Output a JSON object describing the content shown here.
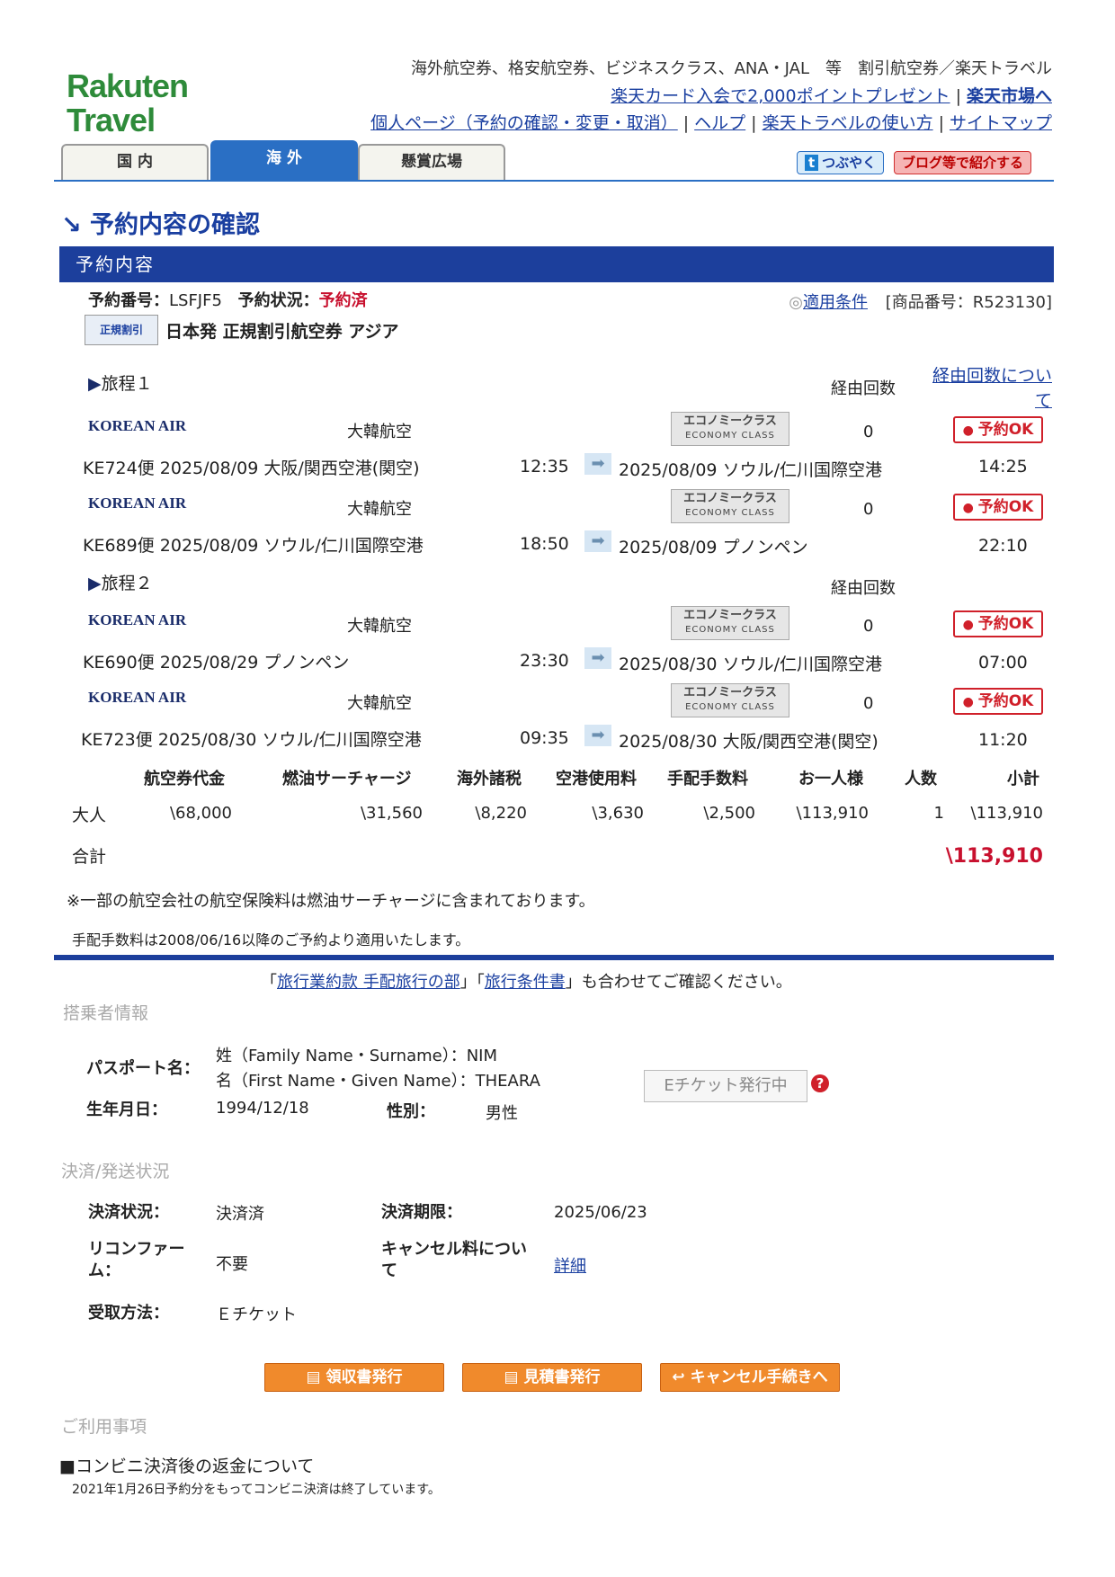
{
  "header": {
    "logo_line1": "Rakuten",
    "logo_line2": "Travel",
    "tagline": "海外航空券、格安航空券、ビジネスクラス、ANA・JAL　等　割引航空券／楽天トラベル",
    "link_card": "楽天カード入会で2,000ポイントプレゼント",
    "link_ichiba": "楽天市場へ",
    "link_mypage": "個人ページ（予約の確認・変更・取消）",
    "link_help": "ヘルプ",
    "link_howto": "楽天トラベルの使い方",
    "link_sitemap": "サイトマップ",
    "tabs": [
      "国 内",
      "海 外",
      "懸賞広場"
    ],
    "sns_tweet": "つぶやく",
    "sns_blog": "ブログ等で紹介する"
  },
  "page_title": "予約内容の確認",
  "section_title": "予約内容",
  "booking": {
    "number_label": "予約番号：",
    "number": "LSFJF5",
    "status_label": "予約状況：",
    "status": "予約済",
    "conditions_link": "適用条件",
    "product_no": "[商品番号：R523130]",
    "badge": "正規割引",
    "product_name": "日本発 正規割引航空券 アジア",
    "via_label": "経由回数",
    "via_link": "経由回数について"
  },
  "itineraries": [
    {
      "label": "旅程１",
      "segments": [
        {
          "airline_logo": "KOREAN AIR",
          "airline": "大韓航空",
          "class_jp": "エコノミークラス",
          "class_en": "ECONOMY CLASS",
          "stops": "0",
          "status": "予約OK",
          "flight": "KE724便",
          "dep_date": "2025/08/09",
          "dep_airport": "大阪/関西空港(関空)",
          "dep_time": "12:35",
          "arr_date": "2025/08/09",
          "arr_airport": "ソウル/仁川国際空港",
          "arr_time": "14:25"
        },
        {
          "airline_logo": "KOREAN AIR",
          "airline": "大韓航空",
          "class_jp": "エコノミークラス",
          "class_en": "ECONOMY CLASS",
          "stops": "0",
          "status": "予約OK",
          "flight": "KE689便",
          "dep_date": "2025/08/09",
          "dep_airport": "ソウル/仁川国際空港",
          "dep_time": "18:50",
          "arr_date": "2025/08/09",
          "arr_airport": "プノンペン",
          "arr_time": "22:10"
        }
      ]
    },
    {
      "label": "旅程２",
      "segments": [
        {
          "airline_logo": "KOREAN AIR",
          "airline": "大韓航空",
          "class_jp": "エコノミークラス",
          "class_en": "ECONOMY CLASS",
          "stops": "0",
          "status": "予約OK",
          "flight": "KE690便",
          "dep_date": "2025/08/29",
          "dep_airport": "プノンペン",
          "dep_time": "23:30",
          "arr_date": "2025/08/30",
          "arr_airport": "ソウル/仁川国際空港",
          "arr_time": "07:00"
        },
        {
          "airline_logo": "KOREAN AIR",
          "airline": "大韓航空",
          "class_jp": "エコノミークラス",
          "class_en": "ECONOMY CLASS",
          "stops": "0",
          "status": "予約OK",
          "flight": "KE723便",
          "dep_date": "2025/08/30",
          "dep_airport": "ソウル/仁川国際空港",
          "dep_time": "09:35",
          "arr_date": "2025/08/30",
          "arr_airport": "大阪/関西空港(関空)",
          "arr_time": "11:20"
        }
      ]
    }
  ],
  "fare": {
    "headers": [
      "航空券代金",
      "燃油サーチャージ",
      "海外諸税",
      "空港使用料",
      "手配手数料",
      "お一人様",
      "人数",
      "小計"
    ],
    "row_label": "大人",
    "row": [
      "\\68,000",
      "\\31,560",
      "\\8,220",
      "\\3,630",
      "\\2,500",
      "\\113,910",
      "1",
      "\\113,910"
    ],
    "total_label": "合計",
    "total": "\\113,910",
    "note1": "※一部の航空会社の航空保険料は燃油サーチャージに含まれております。",
    "note2": "手配手数料は2008/06/16以降のご予約より適用いたします。"
  },
  "confirm": {
    "q1": "「",
    "link1": "旅行業約款 手配旅行の部",
    "q2": "」「",
    "link2": "旅行条件書",
    "tail": "」も合わせてご確認ください。"
  },
  "passenger": {
    "section": "搭乗者情報",
    "passport_label": "パスポート名：",
    "surname": "姓（Family Name・Surname）：NIM",
    "given": "名（First Name・Given Name）：THEARA",
    "dob_label": "生年月日：",
    "dob": "1994/12/18",
    "gender_label": "性別：",
    "gender": "男性",
    "eticket": "Eチケット発行中"
  },
  "payment": {
    "section": "決済/発送状況",
    "status_label": "決済状況：",
    "status": "決済済",
    "deadline_label": "決済期限：",
    "deadline": "2025/06/23",
    "reconfirm_label1": "リコンファー",
    "reconfirm_label2": "ム：",
    "reconfirm": "不要",
    "cancel_label1": "キャンセル料につい",
    "cancel_label2": "て",
    "cancel_link": "詳細",
    "receive_label": "受取方法：",
    "receive": "Ｅチケット"
  },
  "buttons": {
    "receipt": "領収書発行",
    "estimate": "見積書発行",
    "cancel": "キャンセル手続きへ"
  },
  "notes": {
    "section": "ご利用事項",
    "title": "■コンビニ決済後の返金について",
    "text": "2021年1月26日予約分をもってコンビニ決済は終了しています。"
  }
}
